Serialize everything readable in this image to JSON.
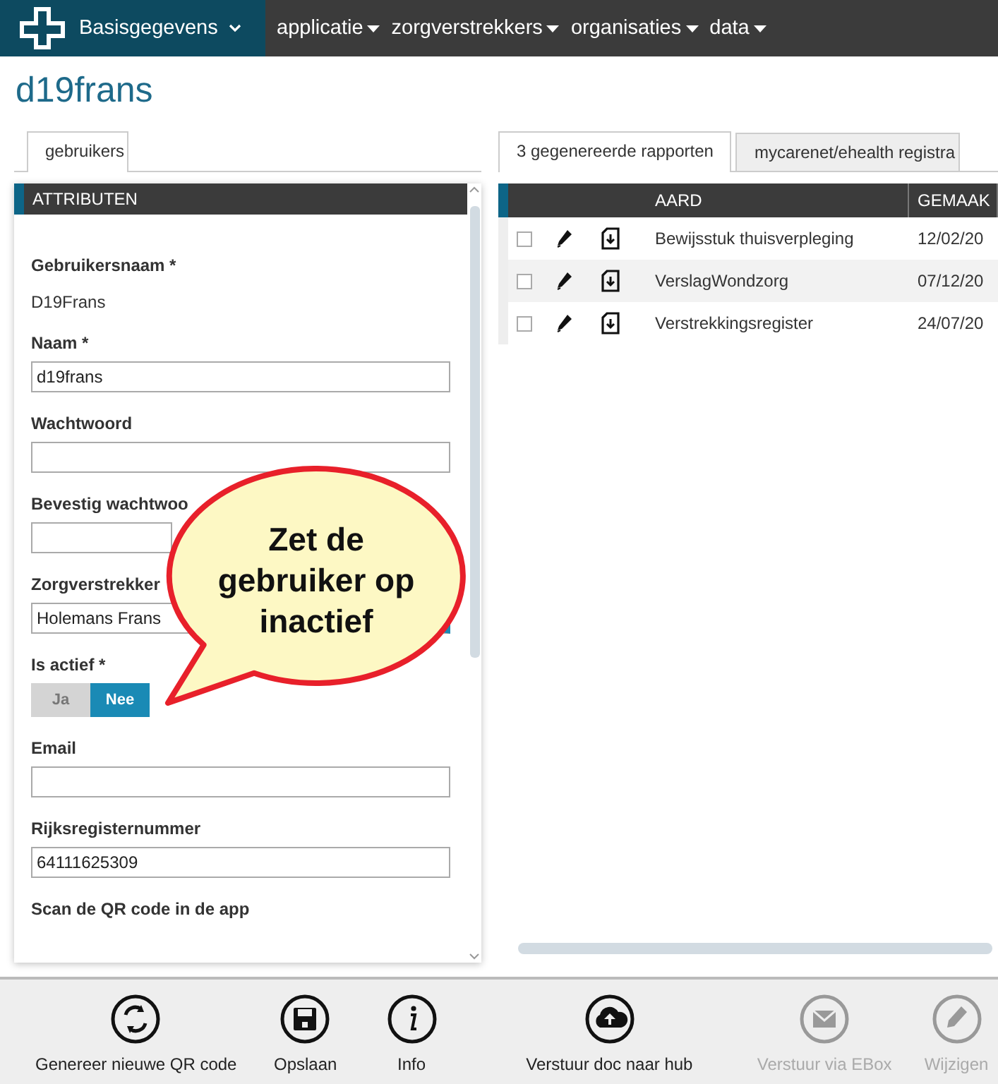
{
  "nav": {
    "brand": "Basisgegevens",
    "menus": [
      "applicatie",
      "zorgverstrekkers",
      "organisaties",
      "data"
    ]
  },
  "page_title": "d19frans",
  "left_tabs": [
    {
      "label": "gebruikers",
      "selected": true
    }
  ],
  "attributes": {
    "header": "ATTRIBUTEN",
    "fields": [
      {
        "kind": "static",
        "label": "Gebruikersnaam *",
        "value": "D19Frans"
      },
      {
        "kind": "input",
        "label": "Naam *",
        "value": "d19frans"
      },
      {
        "kind": "input",
        "label": "Wachtwoord"
      },
      {
        "kind": "input",
        "label": "Bevestig wachtwoo"
      },
      {
        "kind": "select",
        "label": "Zorgverstrekker",
        "value": "Holemans Frans"
      },
      {
        "kind": "toggle",
        "label": "Is actief *",
        "options": [
          {
            "label": "Ja",
            "selected": false
          },
          {
            "label": "Nee",
            "selected": true
          }
        ]
      },
      {
        "kind": "input",
        "label": "Email"
      },
      {
        "kind": "input",
        "label": "Rijksregisternummer",
        "value": "64111625309"
      },
      {
        "kind": "heading",
        "label": "Scan de QR code in de app"
      }
    ]
  },
  "callout": "Zet de gebruiker op inactief",
  "right_tabs": [
    {
      "label": "3 gegenereerde rapporten",
      "selected": true
    },
    {
      "label": "mycarenet/ehealth registra",
      "selected": false
    }
  ],
  "table": {
    "columns": [
      "AARD",
      "GEMAAK"
    ],
    "rows": [
      {
        "checked": false,
        "aard": "Bewijsstuk thuisverpleging",
        "date": "12/02/20"
      },
      {
        "checked": false,
        "aard": "VerslagWondzorg",
        "date": "07/12/20"
      },
      {
        "checked": false,
        "aard": "Verstrekkingsregister",
        "date": "24/07/20"
      }
    ]
  },
  "toolbar": [
    {
      "kind": "qr",
      "label": "Genereer nieuwe QR code",
      "disabled": false
    },
    {
      "kind": "save",
      "label": "Opslaan",
      "disabled": false
    },
    {
      "kind": "info",
      "label": "Info",
      "disabled": false
    },
    {
      "kind": "upload",
      "label": "Verstuur doc naar hub",
      "disabled": false
    },
    {
      "kind": "mail",
      "label": "Verstuur via EBox",
      "disabled": true
    },
    {
      "kind": "edit",
      "label": "Wijzigen",
      "disabled": true
    }
  ]
}
